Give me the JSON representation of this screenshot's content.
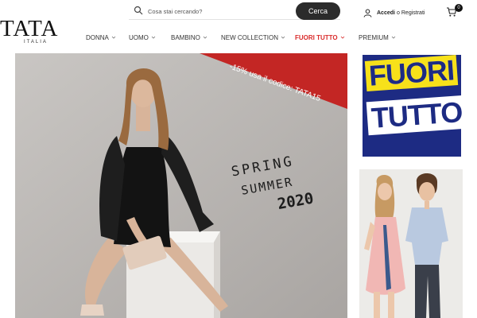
{
  "brand": {
    "name": "TATA",
    "sub": "ITALIA"
  },
  "search": {
    "placeholder": "Cosa stai cercando?",
    "button": "Cerca"
  },
  "account": {
    "login": "Accedi",
    "sep": "o",
    "register": "Registrati"
  },
  "cart": {
    "count": "0"
  },
  "nav": {
    "items": [
      {
        "label": "DONNA"
      },
      {
        "label": "UOMO"
      },
      {
        "label": "BAMBINO"
      },
      {
        "label": "NEW COLLECTION"
      },
      {
        "label": "FUORI TUTTO"
      },
      {
        "label": "PREMIUM"
      }
    ]
  },
  "hero": {
    "promo": "-15% usa il codice: TATA15",
    "season_line1": "SPRING",
    "season_line2": "SUMMER",
    "season_line3": "2020"
  },
  "side_banner": {
    "line1": "FUORI",
    "line2": "TUTTO"
  },
  "colors": {
    "accent_red": "#d92b2b",
    "banner_blue": "#1d2b83",
    "banner_yellow": "#f7e11a",
    "button_dark": "#2b2b2b"
  },
  "icons": {
    "search": "search-icon",
    "user": "user-icon",
    "cart": "cart-icon",
    "chevron": "chevron-down-icon"
  }
}
